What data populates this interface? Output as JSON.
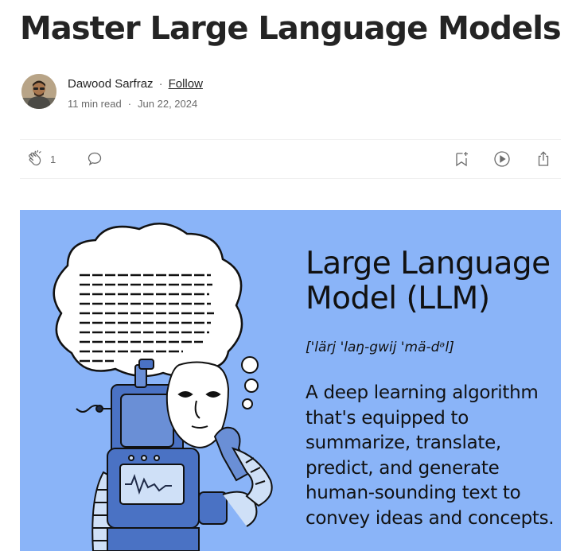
{
  "article": {
    "title": "Master Large Language Models"
  },
  "author": {
    "name": "Dawood Sarfraz",
    "separator": "·",
    "follow_label": "Follow",
    "read_time": "11 min read",
    "meta_separator": "·",
    "date": "Jun 22, 2024"
  },
  "actions": {
    "clap_count": "1",
    "icons": [
      "clap-icon",
      "comment-icon",
      "bookmark-add-icon",
      "play-icon",
      "share-icon"
    ]
  },
  "hero": {
    "background": "#8ab4f8",
    "title_line1": "Large Language",
    "title_line2": "Model (LLM)",
    "pronunciation": "['lärj 'laŋ-gwij 'mä-dᵊl]",
    "description": "A deep learning algorithm that's equipped to summarize, translate, predict, and generate human-sounding text to convey ideas and concepts."
  },
  "colors": {
    "text": "#242424",
    "muted": "#6b6b6b",
    "divider": "#f0f0f0",
    "robot_blue": "#4a72c4",
    "robot_dark": "#1e2a48"
  }
}
